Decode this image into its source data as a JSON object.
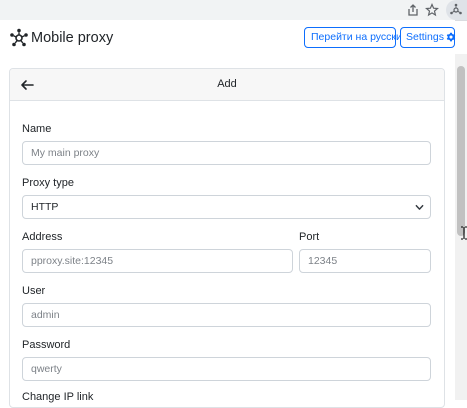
{
  "browser": {
    "icons": [
      "share-icon",
      "star-icon",
      "extension-icon"
    ]
  },
  "header": {
    "title": "Mobile proxy",
    "lang_button": "Перейти на русский",
    "settings_button": "Settings",
    "logo_icon": "network-nodes-icon",
    "settings_icon": "gear-icon",
    "accent_color": "#0d6efd"
  },
  "card": {
    "title": "Add",
    "back_icon": "arrow-left-icon"
  },
  "form": {
    "name": {
      "label": "Name",
      "placeholder": "My main proxy",
      "value": ""
    },
    "proxy_type": {
      "label": "Proxy type",
      "selected": "HTTP"
    },
    "address": {
      "label": "Address",
      "placeholder": "pproxy.site:12345",
      "value": ""
    },
    "port": {
      "label": "Port",
      "placeholder": "12345",
      "value": ""
    },
    "user": {
      "label": "User",
      "placeholder": "admin",
      "value": ""
    },
    "password": {
      "label": "Password",
      "placeholder": "qwerty",
      "value": ""
    },
    "change_ip_link": {
      "label": "Change IP link"
    }
  }
}
